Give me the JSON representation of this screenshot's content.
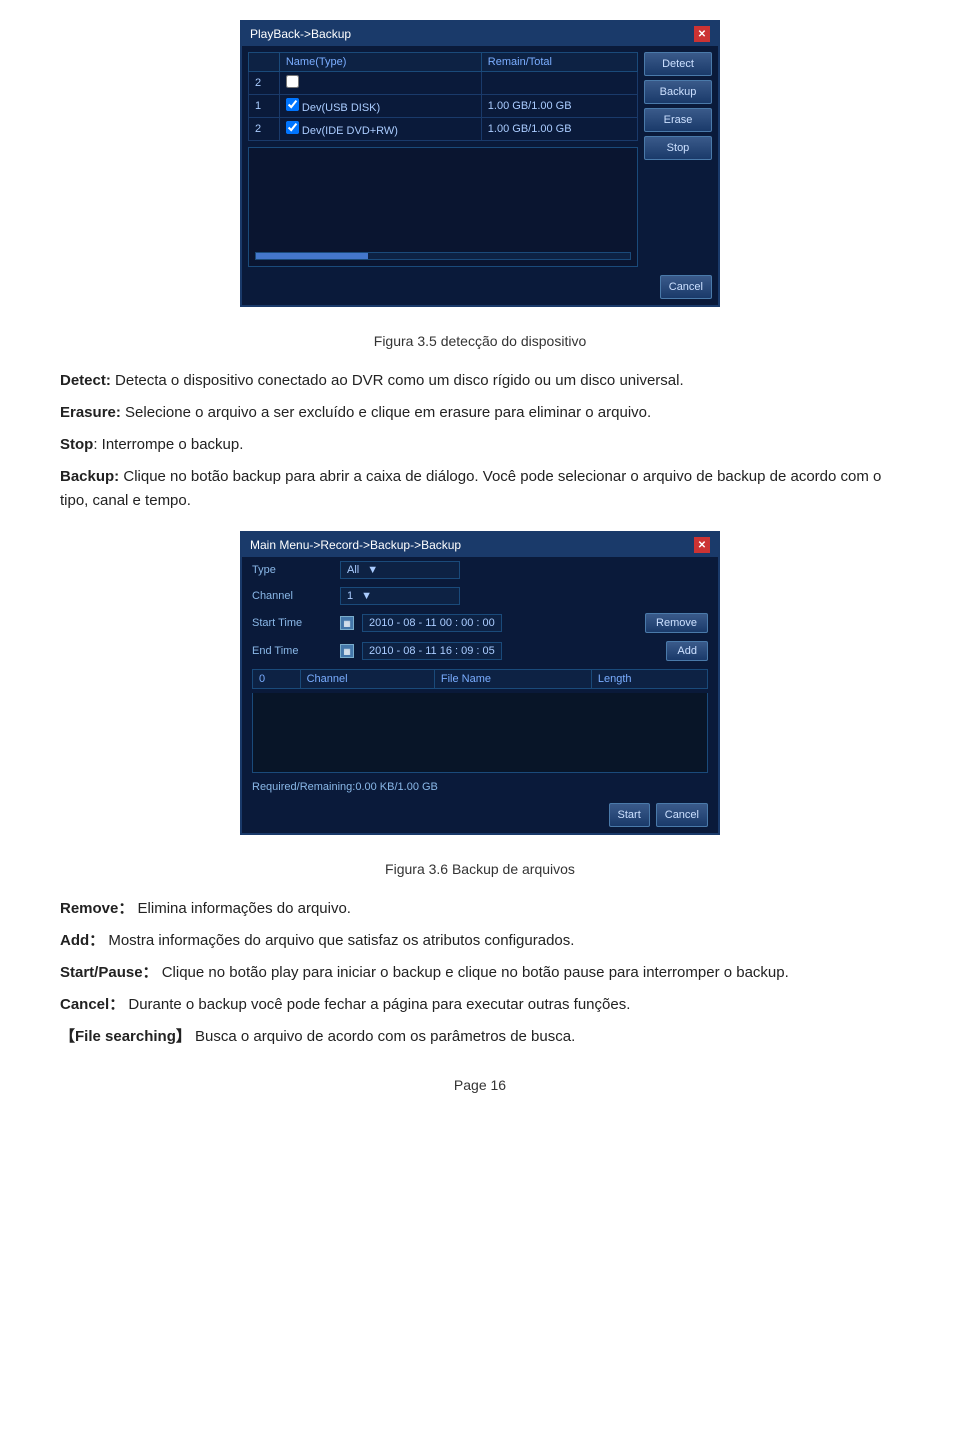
{
  "dialog1": {
    "title": "PlayBack->Backup",
    "table": {
      "headers": [
        "",
        "Name(Type)",
        "Remain/Total"
      ],
      "rows": [
        {
          "num": "2",
          "checked": false,
          "name": "",
          "remain": ""
        },
        {
          "num": "1",
          "checked": true,
          "name": "Dev(USB DISK)",
          "remain": "1.00 GB/1.00 GB"
        },
        {
          "num": "2",
          "checked": true,
          "name": "Dev(IDE DVD+RW)",
          "remain": "1.00 GB/1.00 GB"
        }
      ]
    },
    "buttons": {
      "detect": "Detect",
      "backup": "Backup",
      "erase": "Erase",
      "stop": "Stop",
      "cancel": "Cancel"
    }
  },
  "figure1_caption": "Figura 3.5 detecção do dispositivo",
  "para1": {
    "label": "Detect:",
    "text": " Detecta o dispositivo conectado ao DVR como um disco rígido ou um disco universal."
  },
  "para2": {
    "label": "Erasure:",
    "text": " Selecione o arquivo a ser excluído e clique em erasure para eliminar o arquivo."
  },
  "para3": {
    "label": "Stop",
    "text": ": Interrompe o backup."
  },
  "para4": {
    "label": "Backup:",
    "text": " Clique no botão backup para abrir a caixa de diálogo. Você pode selecionar o arquivo de backup de acordo com o tipo, canal e tempo."
  },
  "dialog2": {
    "title": "Main Menu->Record->Backup->Backup",
    "type_label": "Type",
    "type_value": "All",
    "channel_label": "Channel",
    "channel_value": "1",
    "start_time_label": "Start Time",
    "start_time_value": "2010 - 08 - 11  00 : 00 : 00",
    "end_time_label": "End Time",
    "end_time_value": "2010 - 08 - 11  16 : 09 : 05",
    "remove_btn": "Remove",
    "add_btn": "Add",
    "file_table_headers": [
      "0",
      "Channel",
      "File Name",
      "Length"
    ],
    "status_text": "Required/Remaining:0.00 KB/1.00 GB",
    "start_btn": "Start",
    "cancel_btn": "Cancel"
  },
  "figure2_caption": "Figura 3.6 Backup de arquivos",
  "para5": {
    "label": "Remove：",
    "text": " Elimina informações do arquivo."
  },
  "para6": {
    "label": "Add：",
    "text": " Mostra informações do arquivo que satisfaz os atributos configurados."
  },
  "para7": {
    "label": "Start/Pause：",
    "text": "  Clique no botão play para iniciar o backup e clique no botão pause para interromper o backup."
  },
  "para8": {
    "label": "Cancel：",
    "text": " Durante o backup você pode fechar a página para executar outras funções."
  },
  "para9": {
    "label": "【File searching】",
    "text": " Busca o arquivo de acordo com os parâmetros de busca."
  },
  "page_number": "Page 16"
}
